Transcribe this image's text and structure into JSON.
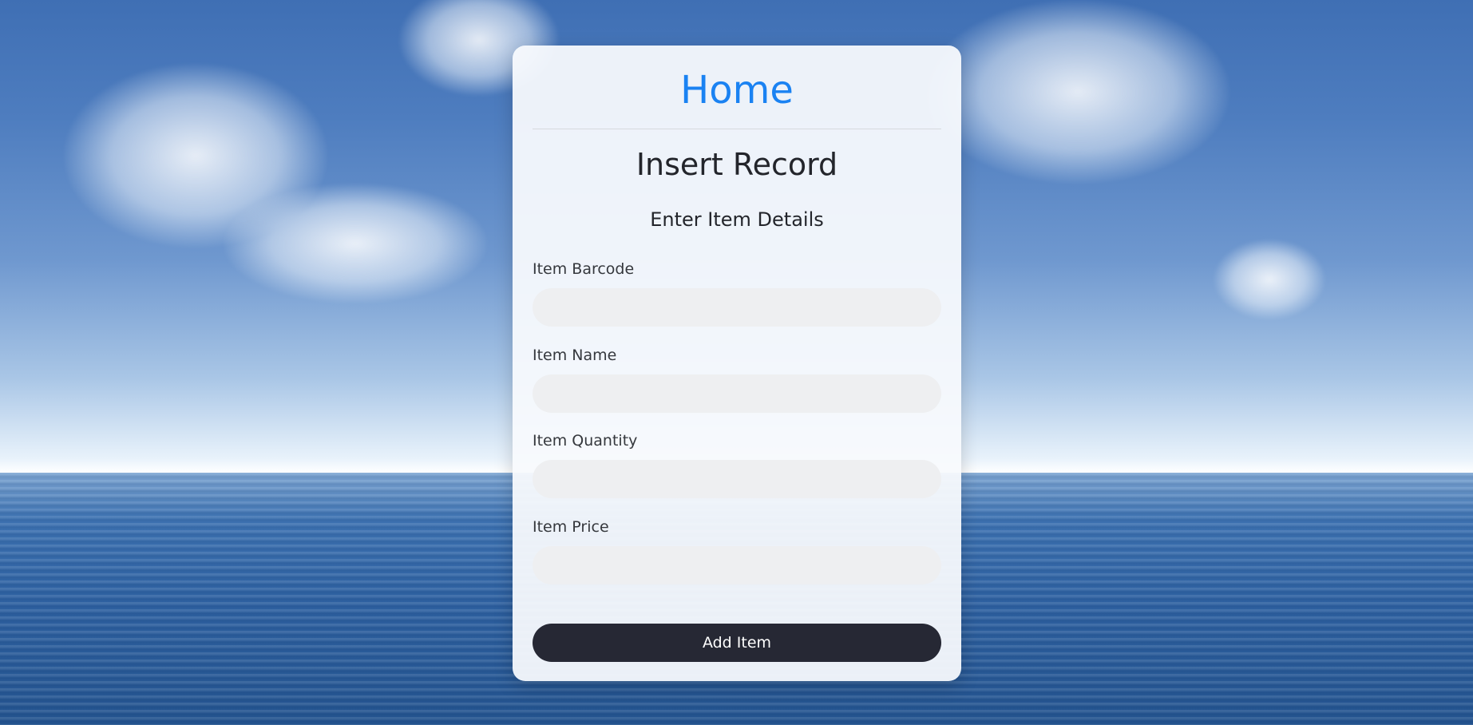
{
  "nav": {
    "home_label": "Home"
  },
  "page": {
    "title": "Insert Record",
    "subtitle": "Enter Item Details"
  },
  "form": {
    "fields": [
      {
        "label": "Item Barcode",
        "value": "",
        "placeholder": ""
      },
      {
        "label": "Item Name",
        "value": "",
        "placeholder": ""
      },
      {
        "label": "Item Quantity",
        "value": "",
        "placeholder": ""
      },
      {
        "label": "Item Price",
        "value": "",
        "placeholder": ""
      }
    ],
    "submit_label": "Add Item"
  },
  "colors": {
    "link": "#1a82f2",
    "button_bg": "#262834",
    "input_bg": "#eeeff1",
    "card_bg": "#f8fafd"
  }
}
